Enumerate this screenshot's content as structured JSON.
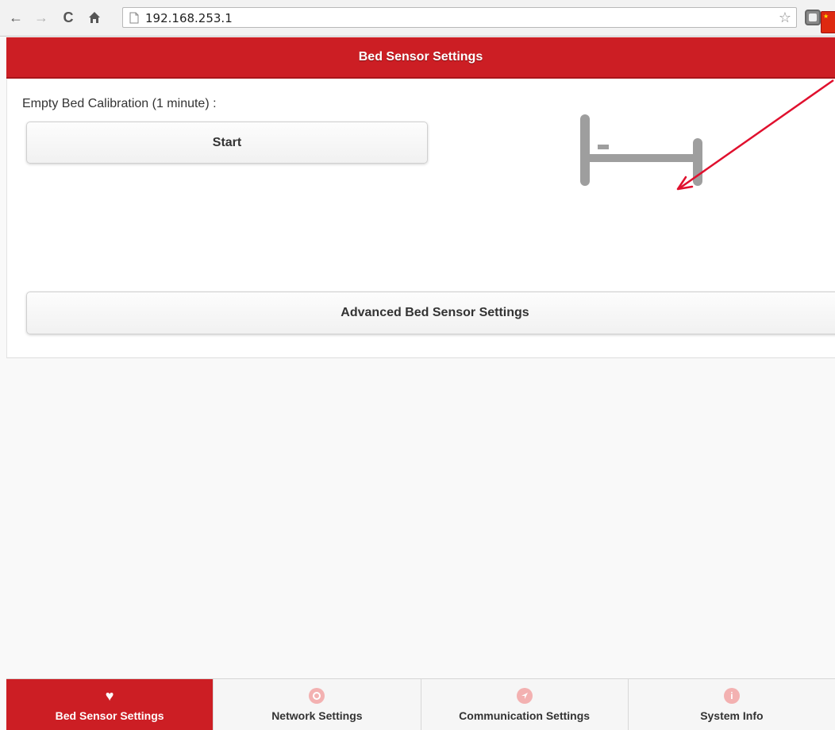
{
  "browser": {
    "url": "192.168.253.1"
  },
  "header": {
    "title": "Bed Sensor Settings"
  },
  "calibration": {
    "label": "Empty Bed Calibration (1 minute) :",
    "start_label": "Start"
  },
  "advanced": {
    "label": "Advanced Bed Sensor Settings"
  },
  "tabs": [
    {
      "label": "Bed Sensor Settings",
      "icon": "heart-icon",
      "active": true
    },
    {
      "label": "Network Settings",
      "icon": "gear-icon",
      "active": false
    },
    {
      "label": "Communication Settings",
      "icon": "navigation-arrow-icon",
      "active": false
    },
    {
      "label": "System Info",
      "icon": "info-icon",
      "active": false
    }
  ],
  "colors": {
    "brand_red": "#cc1e24",
    "annotation_arrow": "#e0102e",
    "bed_icon": "#9e9e9e",
    "inactive_tab_icon": "#f3b1b1"
  }
}
